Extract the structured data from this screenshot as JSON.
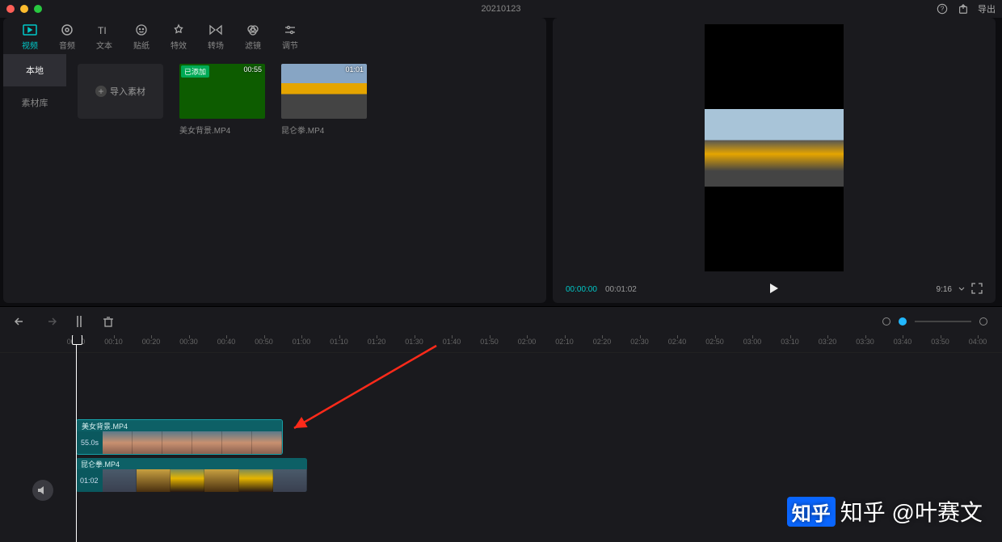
{
  "titlebar": {
    "title": "20210123",
    "export_label": "导出"
  },
  "topnav": {
    "items": [
      {
        "label": "视频"
      },
      {
        "label": "音频"
      },
      {
        "label": "文本"
      },
      {
        "label": "贴纸"
      },
      {
        "label": "特效"
      },
      {
        "label": "转场"
      },
      {
        "label": "滤镜"
      },
      {
        "label": "调节"
      }
    ]
  },
  "sidetabs": {
    "local": "本地",
    "library": "素材库"
  },
  "import_label": "导入素材",
  "media": [
    {
      "name": "美女背景.MP4",
      "duration": "00:55",
      "added_tag": "已添加"
    },
    {
      "name": "昆仑拳.MP4",
      "duration": "01:01"
    }
  ],
  "preview": {
    "current": "00:00:00",
    "duration": "00:01:02",
    "ratio": "9:16"
  },
  "ruler_ticks": [
    "00:00",
    "00:10",
    "00:20",
    "00:30",
    "00:40",
    "00:50",
    "01:00",
    "01:10",
    "01:20",
    "01:30",
    "01:40",
    "01:50",
    "02:00",
    "02:10",
    "02:20",
    "02:30",
    "02:40",
    "02:50",
    "03:00",
    "03:10",
    "03:20",
    "03:30",
    "03:40",
    "03:50",
    "04:00"
  ],
  "clips": [
    {
      "name": "美女背景.MP4",
      "duration_label": "55.0s"
    },
    {
      "name": "昆仑拳.MP4",
      "duration_label": "01:02"
    }
  ],
  "watermark": "知乎 @叶赛文",
  "zh_badge": "知乎"
}
